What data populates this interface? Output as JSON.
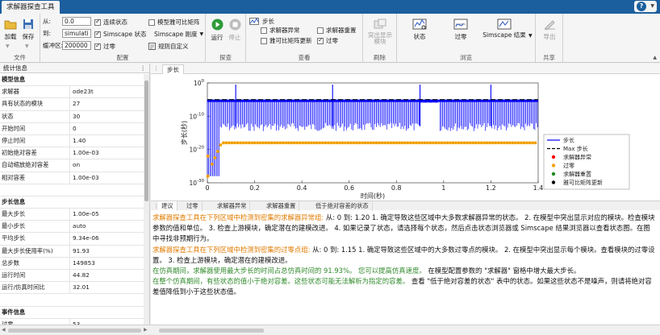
{
  "app": {
    "tab_title": "求解器探查工具",
    "help_label": "?"
  },
  "ribbon": {
    "file": {
      "label": "文件",
      "load": "加载",
      "save": "保存"
    },
    "config": {
      "label": "配置",
      "from_label": "从:",
      "from_value": "0.0",
      "to_label": "到:",
      "to_value": "simulati",
      "buffer_label": "缓冲区:",
      "buffer_value": "200000",
      "continuous_states": "连续状态",
      "simscape_states": "Simscape 状态",
      "zero_crossing": "过零",
      "model_jacobian": "模型雅可比矩阵",
      "simscape_stiffness": "Simscape 刚度",
      "custom_rules": "规则自定义"
    },
    "explore": {
      "label": "探查",
      "run": "运行",
      "stop": "停止"
    },
    "view": {
      "label": "查看",
      "step": "步长",
      "solver_exception": "求解器异常",
      "solver_reset": "求解器重置",
      "jacobian_update": "雅可比矩阵更新",
      "zero_crossing": "过零"
    },
    "highlight": {
      "label": "刷除",
      "button": "突出显示模块"
    },
    "browse": {
      "label": "浏览",
      "states": "状态",
      "zero_crossing": "过零",
      "simscape_results": "Simscape 结果"
    },
    "share": {
      "label": "共享",
      "export": "导出"
    }
  },
  "stats": {
    "title": "统计信息",
    "sections": [
      {
        "header": "模型信息",
        "rows": [
          {
            "k": "求解器",
            "v": "ode23t"
          },
          {
            "k": "具有状态的模块",
            "v": "27"
          },
          {
            "k": "状态",
            "v": "30"
          },
          {
            "k": "开始时间",
            "v": "0"
          },
          {
            "k": "停止时间",
            "v": "1.40"
          },
          {
            "k": "初始绝对容差",
            "v": "1.00e-03"
          },
          {
            "k": "自动缩放绝对容差",
            "v": "on"
          },
          {
            "k": "相对容差",
            "v": "1.00e-03"
          }
        ]
      },
      {
        "header": "步长信息",
        "rows": [
          {
            "k": "最大步长",
            "v": "1.00e-05"
          },
          {
            "k": "最小步长",
            "v": "auto"
          },
          {
            "k": "平均步长",
            "v": "9.34e-06"
          },
          {
            "k": "最大步长使用率(%)",
            "v": "91.93"
          },
          {
            "k": "总步数",
            "v": "149853"
          },
          {
            "k": "运行时间",
            "v": "44.82"
          },
          {
            "k": "运行/仿真时间比",
            "v": "32.01"
          }
        ]
      },
      {
        "header": "事件信息",
        "rows": [
          {
            "k": "过零",
            "v": "53"
          }
        ]
      }
    ]
  },
  "doc_tab": "步长",
  "chart_data": {
    "type": "line",
    "xlabel": "时间(秒)",
    "ylabel": "步长(秒)",
    "xlim": [
      0,
      1.4
    ],
    "x_ticks": [
      "0",
      "0.2",
      "0.4",
      "0.6",
      "0.8",
      "1",
      "1.2",
      "1.4"
    ],
    "y_scale": "log",
    "ylim": [
      1e-30,
      1
    ],
    "y_ticks": [
      "10^0",
      "10^-10",
      "10^-20",
      "10^-30"
    ],
    "y_tick_base": "10",
    "y_tick_exps": [
      "0",
      "-10",
      "-20",
      "-30"
    ],
    "legend_position": "right",
    "series": [
      {
        "name": "步长",
        "color": "#0000ff"
      },
      {
        "name": "Max 步长",
        "color": "#000000",
        "value": 1e-05
      },
      {
        "name": "求解器异常",
        "color": "#ff0000"
      },
      {
        "name": "过零",
        "color": "#f0a000"
      },
      {
        "name": "求解器重置",
        "color": "#1a8a1a"
      },
      {
        "name": "雅可比矩阵更新",
        "color": "#000000"
      }
    ]
  },
  "bottom_tabs": [
    "建议",
    "过零",
    "求解器异常",
    "求解器重置",
    "低于绝对容差的状态"
  ],
  "report": [
    {
      "parts": [
        {
          "t": "求解器探查工具在下列区域中检测到密集的求解器异常组: ",
          "c": "orange"
        },
        {
          "t": "从: 0 到: 1.20 1. 确定导致这些区域中大多数求解器异常的状态。 2. 在模型中突出显示对应的模块。检查模块参数的值和单位。 3. 检查上游模块，确定潜在的建模改进。 4. 如果记录了状态，请选择每个状态，然后点击状态浏览器或 Simscape 结果浏览器以查看状态图。在图中寻找非预期行为。",
          "c": ""
        }
      ]
    },
    {
      "parts": [
        {
          "t": "求解器探查工具在下列区域中检测到密集的过零点组: ",
          "c": "orange"
        },
        {
          "t": "从: 0 到: 1.15 1. 确定导致这些区域中的大多数过零点的模块。 2. 在模型中突出显示每个模块。查看模块的过零设置。 3. 检查上游模块，确定潜在的建模改进。",
          "c": ""
        }
      ]
    },
    {
      "parts": [
        {
          "t": "在仿真期间，求解器使用最大步长的时间占总仿真时间的 91.93%。 您可以提高仿真速度。",
          "c": "green"
        },
        {
          "t": " 在模型配置参数的 \"求解器\" 窗格中增大最大步长。",
          "c": ""
        }
      ]
    },
    {
      "parts": [
        {
          "t": "在整个仿真期间，有些状态的值小于绝对容差。这些状态可能无法解析为指定的容差。",
          "c": "green"
        },
        {
          "t": " 查看 \"低于绝对容差的状态\" 表中的状态。如果这些状态不是噪声，则请将绝对容差值降低到小于这些状态值。",
          "c": ""
        }
      ]
    }
  ]
}
